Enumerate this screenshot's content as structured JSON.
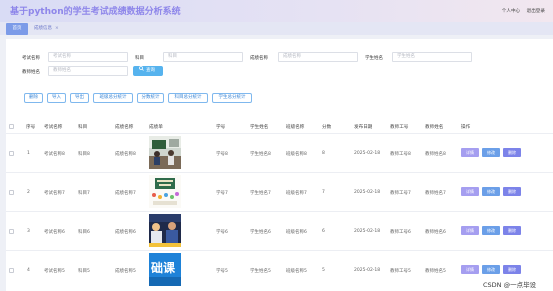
{
  "header": {
    "title": "基于python的学生考试成绩数据分析系统",
    "links": [
      "个人中心",
      "退出登录"
    ]
  },
  "tabs": [
    {
      "label": "首页"
    },
    {
      "label": "成绩信息",
      "close": "×"
    }
  ],
  "filters": {
    "exam_name": {
      "label": "考试名称",
      "placeholder": "考试名称"
    },
    "subject": {
      "label": "科目",
      "placeholder": "科目"
    },
    "grade_name": {
      "label": "成绩名称",
      "placeholder": "成绩名称"
    },
    "student_name": {
      "label": "学生姓名",
      "placeholder": "学生姓名"
    },
    "teacher_name": {
      "label": "教师姓名",
      "placeholder": "教师姓名"
    },
    "search_button": "查询"
  },
  "toolbar": [
    "删除",
    "导入",
    "导出",
    "班级总分统计",
    "分数统计",
    "科目总分统计",
    "学生总分统计"
  ],
  "table": {
    "columns": [
      "序号",
      "考试名称",
      "科目",
      "成绩名称",
      "成绩单",
      "学号",
      "学生姓名",
      "班级名称",
      "分数",
      "发布日期",
      "教师工号",
      "教师姓名",
      "操作"
    ],
    "rows": [
      {
        "index": "1",
        "exam": "考试名称8",
        "subject": "科目8",
        "grade": "成绩名称8",
        "student_no": "学号8",
        "student_name": "学生姓名8",
        "class": "班级名称8",
        "score": "8",
        "date": "2025-02-18",
        "teacher_no": "教师工号8",
        "teacher_name": "教师姓名8"
      },
      {
        "index": "2",
        "exam": "考试名称7",
        "subject": "科目7",
        "grade": "成绩名称7",
        "student_no": "学号7",
        "student_name": "学生姓名7",
        "class": "班级名称7",
        "score": "7",
        "date": "2025-02-18",
        "teacher_no": "教师工号7",
        "teacher_name": "教师姓名7"
      },
      {
        "index": "3",
        "exam": "考试名称6",
        "subject": "科目6",
        "grade": "成绩名称6",
        "student_no": "学号6",
        "student_name": "学生姓名6",
        "class": "班级名称6",
        "score": "6",
        "date": "2025-02-18",
        "teacher_no": "教师工号6",
        "teacher_name": "教师姓名6"
      },
      {
        "index": "4",
        "exam": "考试名称5",
        "subject": "科目5",
        "grade": "成绩名称5",
        "student_no": "学号5",
        "student_name": "学生姓名5",
        "class": "班级名称5",
        "score": "5",
        "date": "2025-02-18",
        "teacher_no": "教师工号5",
        "teacher_name": "教师姓名5"
      }
    ],
    "actions": [
      "详情",
      "修改",
      "删除"
    ]
  },
  "cover_texts": {
    "row4": "础课"
  },
  "watermark": "CSDN @一点毕设",
  "colors": {
    "title": "#8e86ea",
    "tab_active": "#7c9be8",
    "search_button": "#56b3ee",
    "detail_button": "#a59ef0",
    "edit_button": "#6b9fe8",
    "delete_button": "#7c83e9"
  }
}
